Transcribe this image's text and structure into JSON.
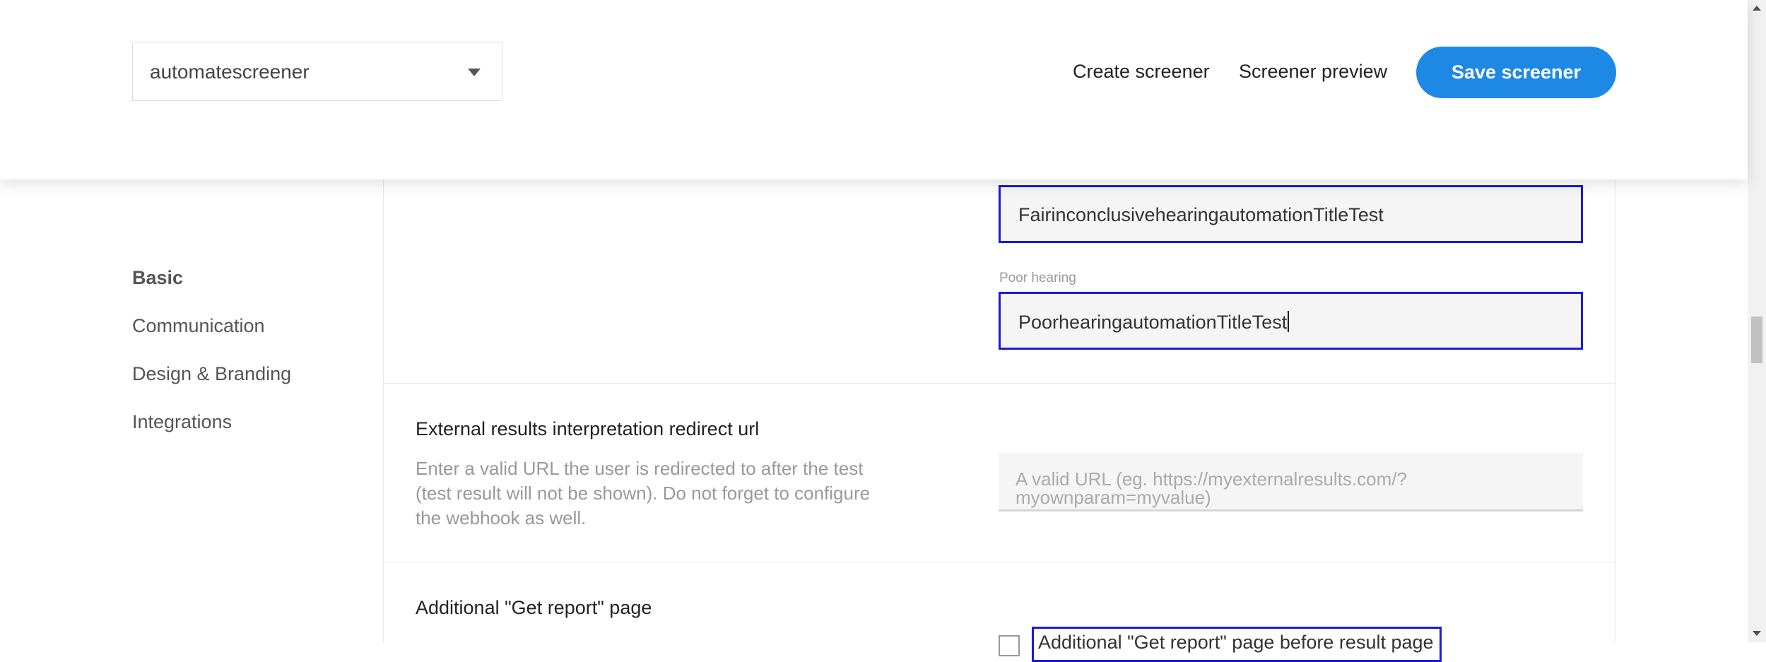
{
  "header": {
    "screener_select": {
      "value": "automatescreener"
    },
    "nav": {
      "create": "Create screener",
      "preview": "Screener preview"
    },
    "save_label": "Save screener",
    "accent_color": "#1e88e5"
  },
  "sidebar": {
    "items": [
      {
        "label": "Basic",
        "active": true
      },
      {
        "label": "Communication",
        "active": false
      },
      {
        "label": "Design & Branding",
        "active": false
      },
      {
        "label": "Integrations",
        "active": false
      }
    ]
  },
  "results": {
    "fair_value": "FairinconclusivehearingautomationTitleTest",
    "poor_label": "Poor hearing",
    "poor_value": "PoorhearingautomationTitleTest"
  },
  "external": {
    "title": "External results interpretation redirect url",
    "description": "Enter a valid URL the user is redirected to after the test (test result will not be shown). Do not forget to configure the webhook as well.",
    "placeholder": "A valid URL (eg. https://myexternalresults.com/?myownparam=myvalue)"
  },
  "get_report": {
    "title": "Additional \"Get report\" page",
    "checkbox_label": "Additional \"Get report\" page before result page"
  },
  "icons": {
    "dropdown": "chevron-down-icon",
    "scroll_up": "arrow-up-icon",
    "scroll_down": "arrow-down-icon"
  }
}
